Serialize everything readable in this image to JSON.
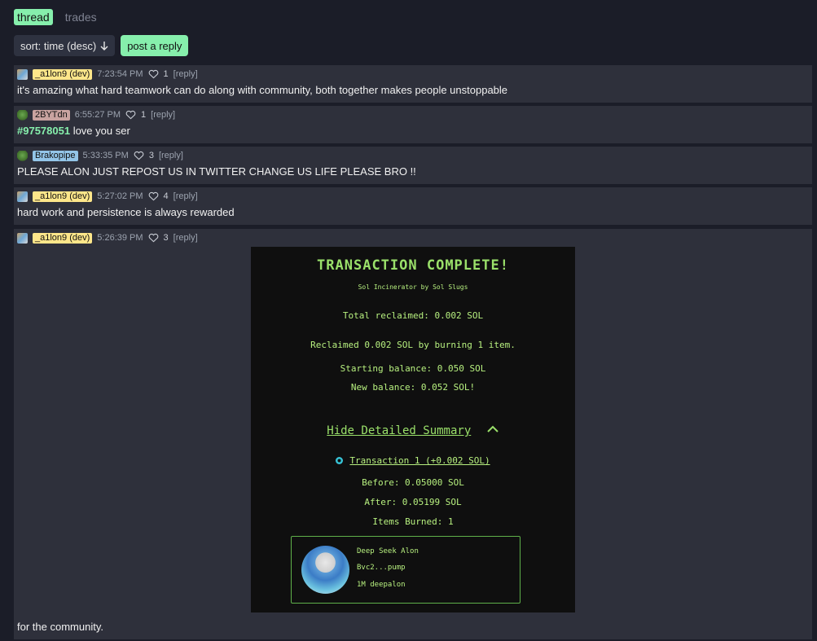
{
  "tabs": [
    {
      "label": "thread"
    },
    {
      "label": "trades"
    }
  ],
  "controls": {
    "sort_label": "sort: time (desc)",
    "reply_label": "post a reply"
  },
  "posts": [
    {
      "user": "_a1lon9 (dev)",
      "user_color": "#fde68a",
      "time": "7:23:54 PM",
      "likes": "1",
      "reply": "[reply]",
      "text": "it's amazing what hard teamwork can do along with community, both together makes people unstoppable"
    },
    {
      "user": "2BYTdn",
      "user_color": "#c9a3a0",
      "time": "6:55:27 PM",
      "likes": "1",
      "reply": "[reply]",
      "mention": "#97578051",
      "text": " love you ser"
    },
    {
      "user": "Brakopipe",
      "user_color": "#93c5e8",
      "time": "5:33:35 PM",
      "likes": "3",
      "reply": "[reply]",
      "text": "PLEASE ALON JUST REPOST US IN TWITTER CHANGE US LIFE PLEASE BRO !!"
    },
    {
      "user": "_a1lon9 (dev)",
      "user_color": "#fde68a",
      "time": "5:27:02 PM",
      "likes": "4",
      "reply": "[reply]",
      "text": "hard work and persistence is always rewarded"
    },
    {
      "user": "_a1lon9 (dev)",
      "user_color": "#fde68a",
      "time": "5:26:39 PM",
      "likes": "3",
      "reply": "[reply]",
      "text": "for the community."
    }
  ],
  "image": {
    "title": "TRANSACTION COMPLETE!",
    "subtitle": "Sol Incinerator by Sol Slugs",
    "total": "Total reclaimed: 0.002 SOL",
    "reclaimed": "Reclaimed 0.002 SOL by burning 1 item.",
    "start": "Starting balance: 0.050 SOL",
    "new": "New balance: 0.052 SOL!",
    "hide": "Hide Detailed Summary",
    "tx": "Transaction 1 (+0.002 SOL)",
    "before": "Before: 0.05000 SOL",
    "after": "After: 0.05199 SOL",
    "burned": "Items Burned: 1",
    "card_name": "Deep Seek Alon",
    "card_addr": "Bvc2...pump",
    "card_amount": "1M deepalon"
  }
}
